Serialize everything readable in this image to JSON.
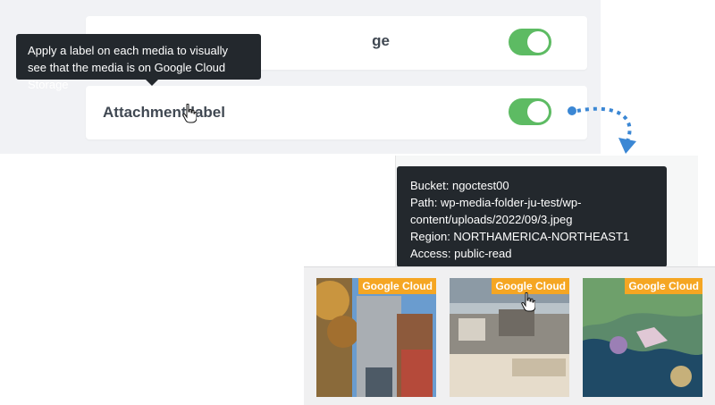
{
  "settings": {
    "cards": [
      {
        "label": "Label on Google Cloud Storage",
        "visible_label": "ge",
        "toggle_on": true
      },
      {
        "label": "Attachment label",
        "toggle_on": true
      }
    ],
    "tooltip": "Apply a label on each media to visually see that the media is on Google Cloud Storage"
  },
  "media_info": {
    "lines": [
      "Bucket: ngoctest00",
      "Path: wp-media-folder-ju-test/wp-",
      "content/uploads/2022/09/3.jpeg",
      "Region: NORTHAMERICA-NORTHEAST1",
      "Access: public-read"
    ]
  },
  "media_grid": {
    "items": [
      {
        "label": "Google Cloud",
        "icon": "building-photo"
      },
      {
        "label": "Google Cloud",
        "icon": "construction-photo"
      },
      {
        "label": "Google Cloud",
        "icon": "map-photo"
      }
    ]
  },
  "colors": {
    "toggle_on": "#5dbb63",
    "tooltip_bg": "#23282d",
    "gc_label_bg": "#f5a623",
    "arrow": "#3b87d4"
  }
}
